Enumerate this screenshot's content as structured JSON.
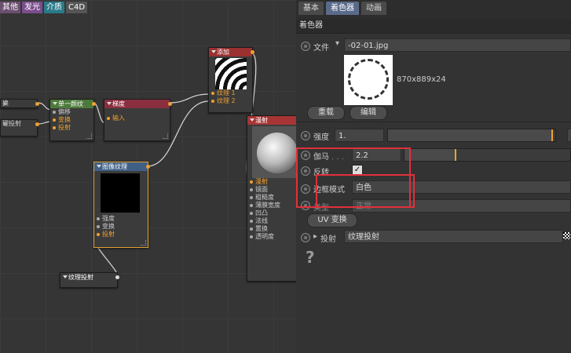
{
  "canvas": {
    "tabs": [
      "其他",
      "发光",
      "介质",
      "C4D"
    ],
    "nodes": {
      "left_a": {
        "label": "换"
      },
      "left_b": {
        "label": "理投射"
      },
      "single_texture": {
        "title": "单一颜纹",
        "ports": [
          "偏移",
          "变换",
          "投射"
        ]
      },
      "gradient": {
        "title": "梯度",
        "input": "输入"
      },
      "add": {
        "title": "添加",
        "ports": [
          "纹理 1",
          "纹理 2"
        ]
      },
      "diffuse": {
        "title": "漫射",
        "ports": [
          "漫射",
          "镜面",
          "粗糙度",
          "薄膜宽度",
          "凹凸",
          "法线",
          "置换",
          "透明度"
        ]
      },
      "image_texture": {
        "title": "图像纹理",
        "ports": [
          "强度",
          "变换",
          "投射"
        ]
      },
      "texture_projection": {
        "title": "纹理投射"
      }
    }
  },
  "panel": {
    "tabs": [
      "基本",
      "着色器",
      "动画"
    ],
    "active_tab": "着色器",
    "section_title": "着色器",
    "file": {
      "label": "文件",
      "value": "-02-01.jpg",
      "dims": "870x889x24"
    },
    "buttons": {
      "reload": "重载",
      "edit": "编辑",
      "uv": "UV 变换"
    },
    "strength": {
      "label": "强度",
      "value": "1.",
      "fraction": 0.98
    },
    "gamma": {
      "label": "伽马",
      "value": "2.2",
      "fraction": 0.31
    },
    "invert": {
      "label": "反转",
      "checked": true
    },
    "border_mode": {
      "label": "边框模式",
      "value": "白色"
    },
    "type": {
      "label": "类型",
      "value": "正常"
    },
    "projection": {
      "label": "投射",
      "value": "纹理投射"
    },
    "help": "?"
  }
}
